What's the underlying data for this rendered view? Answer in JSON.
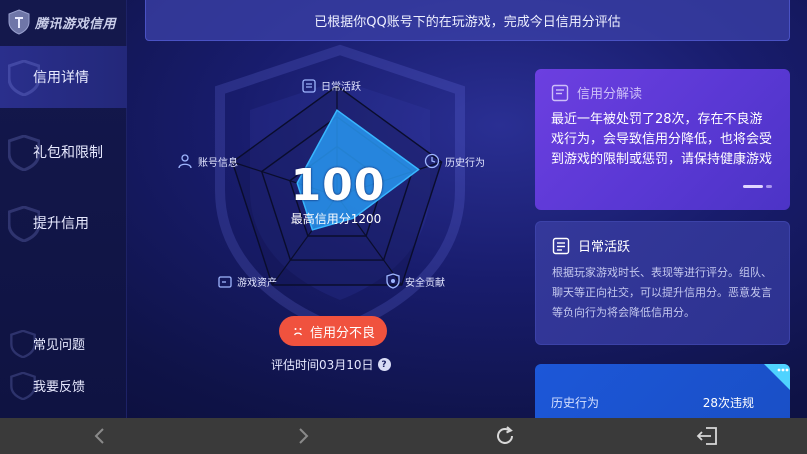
{
  "app": {
    "brand_name": "腾讯游戏信用",
    "accent": "#2f36a8",
    "sidebar_active_bg": "#2a2f8c"
  },
  "sidebar": {
    "items": [
      {
        "label": "信用详情",
        "active": true
      },
      {
        "label": "礼包和限制",
        "active": false
      },
      {
        "label": "提升信用",
        "active": false
      }
    ],
    "footer_items": [
      {
        "label": "常见问题"
      },
      {
        "label": "我要反馈"
      }
    ]
  },
  "banner": {
    "text": "已根据你QQ账号下的在玩游戏，完成今日信用分评估"
  },
  "radar": {
    "score": "100",
    "max_label": "最高信用分1200",
    "axes": [
      {
        "label": "日常活跃",
        "icon": "list-icon",
        "value": 0.78
      },
      {
        "label": "历史行为",
        "icon": "clock-icon",
        "value": 0.78
      },
      {
        "label": "安全贡献",
        "icon": "shield-check-icon",
        "value": 0.25
      },
      {
        "label": "游戏资产",
        "icon": "wallet-icon",
        "value": 0.38
      },
      {
        "label": "账号信息",
        "icon": "user-icon",
        "value": 0.38
      }
    ],
    "status": {
      "label": "信用分不良",
      "icon": "sad-face-icon",
      "color": "#f0523e"
    },
    "eval_time": "评估时间03月10日"
  },
  "cards": {
    "interpret": {
      "title": "信用分解读",
      "body": "最近一年被处罚了28次，存在不良游戏行为，会导致信用分降低，也将会受到游戏的限制或惩罚，请保持健康游戏"
    },
    "daily": {
      "title": "日常活跃",
      "body": "根据玩家游戏时长、表现等进行评分。组队、聊天等正向社交，可以提升信用分。恶意发言等负向行为将会降低信用分。"
    },
    "history": {
      "label": "历史行为",
      "value": "28次违规"
    }
  },
  "navbar": {
    "buttons": [
      "back-arrow-icon",
      "forward-arrow-icon",
      "refresh-icon",
      "exit-icon"
    ]
  }
}
